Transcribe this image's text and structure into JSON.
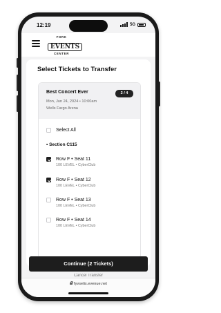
{
  "status_bar": {
    "time": "12:19",
    "network": "5G"
  },
  "header": {
    "logo_top": "FORK",
    "logo_main": "EVENTS",
    "logo_bottom": "CENTER"
  },
  "card": {
    "title": "Select Tickets to Transfer",
    "event": {
      "name": "Best Concert Ever",
      "date": "Mon, Jun 24, 2024 • 10:00am",
      "venue": "Wells Fargo Arena",
      "pager": "2 / 4"
    },
    "select_all": {
      "label": "Select All",
      "checked": false
    },
    "section_label": "• Section C115",
    "tickets": [
      {
        "label": "Row F • Seat 11",
        "detail": "100 LEVEL • CyberClub",
        "checked": true
      },
      {
        "label": "Row F • Seat 12",
        "detail": "100 LEVEL • CyberClub",
        "checked": true
      },
      {
        "label": "Row F • Seat 13",
        "detail": "100 LEVEL • CyberClub",
        "checked": false
      },
      {
        "label": "Row F • Seat 14",
        "detail": "100 LEVEL • CyberClub",
        "checked": false
      }
    ]
  },
  "continue_button": "Continue (2 Tickets)",
  "behind_text": "Cancel Transfer",
  "browser": {
    "url": "fyvsetix.evenue.net"
  }
}
